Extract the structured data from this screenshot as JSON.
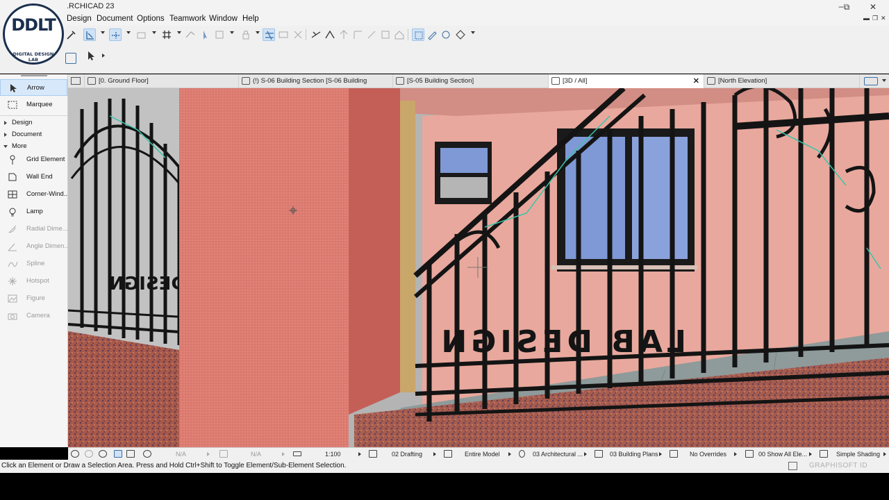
{
  "app": {
    "title": ".RCHICAD 23"
  },
  "logo": {
    "initials": "DDLT",
    "ring_text": "DIGITAL DESIGN LAB"
  },
  "menu": [
    "Design",
    "Document",
    "Options",
    "Teamwork",
    "Window",
    "Help"
  ],
  "window_controls": {
    "minimize": "–",
    "restore": "⧉",
    "close": "✕"
  },
  "tabs": [
    {
      "label": "[0. Ground Floor]"
    },
    {
      "label": "(!) S-06 Building Section [S-06 Building Section]"
    },
    {
      "label": "[S-05 Building Section]"
    },
    {
      "label": "[3D / All]",
      "close": "✕"
    },
    {
      "label": "[North Elevation]"
    }
  ],
  "toolbox": {
    "top_tools": [
      "Arrow",
      "Marquee"
    ],
    "groups": [
      "Design",
      "Document",
      "More"
    ],
    "more_tools": [
      {
        "label": "Grid Element",
        "icon": "grid-element-icon",
        "disabled": false
      },
      {
        "label": "Wall End",
        "icon": "wall-end-icon",
        "disabled": false
      },
      {
        "label": "Corner-Wind...",
        "icon": "corner-window-icon",
        "disabled": false
      },
      {
        "label": "Lamp",
        "icon": "lamp-icon",
        "disabled": false
      },
      {
        "label": "Radial Dime...",
        "icon": "radial-dimension-icon",
        "disabled": true
      },
      {
        "label": "Angle Dimen...",
        "icon": "angle-dimension-icon",
        "disabled": true
      },
      {
        "label": "Spline",
        "icon": "spline-icon",
        "disabled": true
      },
      {
        "label": "Hotspot",
        "icon": "hotspot-icon",
        "disabled": true
      },
      {
        "label": "Figure",
        "icon": "figure-icon",
        "disabled": true
      },
      {
        "label": "Camera",
        "icon": "camera-icon",
        "disabled": true
      }
    ]
  },
  "quick_options": {
    "na1": "N/A",
    "na2": "N/A",
    "scale": "1:100",
    "layer_combo": "02 Drafting",
    "model_view": "Entire Model",
    "pen_set": "03 Architectural ...",
    "mvo": "03 Building Plans",
    "overrides": "No Overrides",
    "renovation": "00 Show All Ele...",
    "shading": "Simple Shading"
  },
  "status": {
    "message": "Click an Element or Draw a Selection Area. Press and Hold Ctrl+Shift to Toggle Element/Sub-Element Selection.",
    "brand": "GRAPHISOFT ID"
  },
  "colors": {
    "accent_selection": "#cfe2f6",
    "wall_pink": "#e9a89d",
    "column_red": "#d56c63",
    "iron_black": "#141414",
    "glass_blue": "#7f98d6"
  }
}
